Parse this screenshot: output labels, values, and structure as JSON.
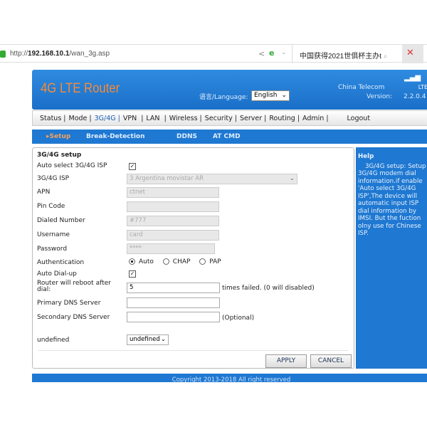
{
  "browser": {
    "url_prefix": "http://",
    "url_host": "192.168.10.1",
    "url_path": "/wan_3g.asp",
    "search_text": "中国获得2021世俱杯主办t",
    "close_icon": "✕"
  },
  "header": {
    "title": "4G LTE Router",
    "language_label": "语言/Language:",
    "language_value": "English",
    "isp": "China Telecom",
    "version_label": "Version:",
    "network": "LTE",
    "version": "2.2.0.4",
    "signal_icon": "signal-icon"
  },
  "nav": [
    {
      "label": "Status |"
    },
    {
      "label": "Mode |"
    },
    {
      "label": "3G/4G |"
    },
    {
      "label": "VPN  |"
    },
    {
      "label": "LAN  |"
    },
    {
      "label": "Wireless |"
    },
    {
      "label": "Security |"
    },
    {
      "label": "Server |"
    },
    {
      "label": "Routing |"
    },
    {
      "label": "Admin |"
    },
    {
      "label": "Logout"
    }
  ],
  "subnav": {
    "setup": "▸Setup",
    "break": "Break-Detection",
    "ddns": "DDNS",
    "atcmd": "AT CMD"
  },
  "form": {
    "title": "3G/4G setup",
    "auto_isp_label": "Auto select 3G/4G ISP",
    "auto_isp_checked": true,
    "isp_label": "3G/4G ISP",
    "isp_value": "3 Argentina movistar AR",
    "apn_label": "APN",
    "apn_value": "ctnet",
    "pin_label": "Pin Code",
    "pin_value": "",
    "dialed_label": "Dialed Number",
    "dialed_value": "#777",
    "user_label": "Username",
    "user_value": "card",
    "pass_label": "Password",
    "pass_value": "****",
    "auth_label": "Authentication",
    "auth_options": [
      "Auto",
      "CHAP",
      "PAP"
    ],
    "auth_selected": "Auto",
    "dialup_label": "Auto Dial-up",
    "dialup_checked": true,
    "reboot_label": "Router will reboot after dial:",
    "reboot_value": "5",
    "reboot_suffix": "times failed. (0 will disabled)",
    "dns1_label": "Primary DNS Server",
    "dns2_label": "Secondary DNS Server",
    "dns2_suffix": "(Optional)",
    "undef_label": "undefined",
    "undef_value": "undefined",
    "apply": "APPLY",
    "cancel": "CANCEL"
  },
  "help": {
    "title": "Help",
    "text": "3G/4G setup: Setup 3G/4G modem dial information.if enable 'Auto select 3G/4G ISP',The device will automatic input ISP dial information by IMSI. But the fuction olny use for Chinese ISP."
  },
  "footer": "Copyright 2013-2018 All right reserved"
}
